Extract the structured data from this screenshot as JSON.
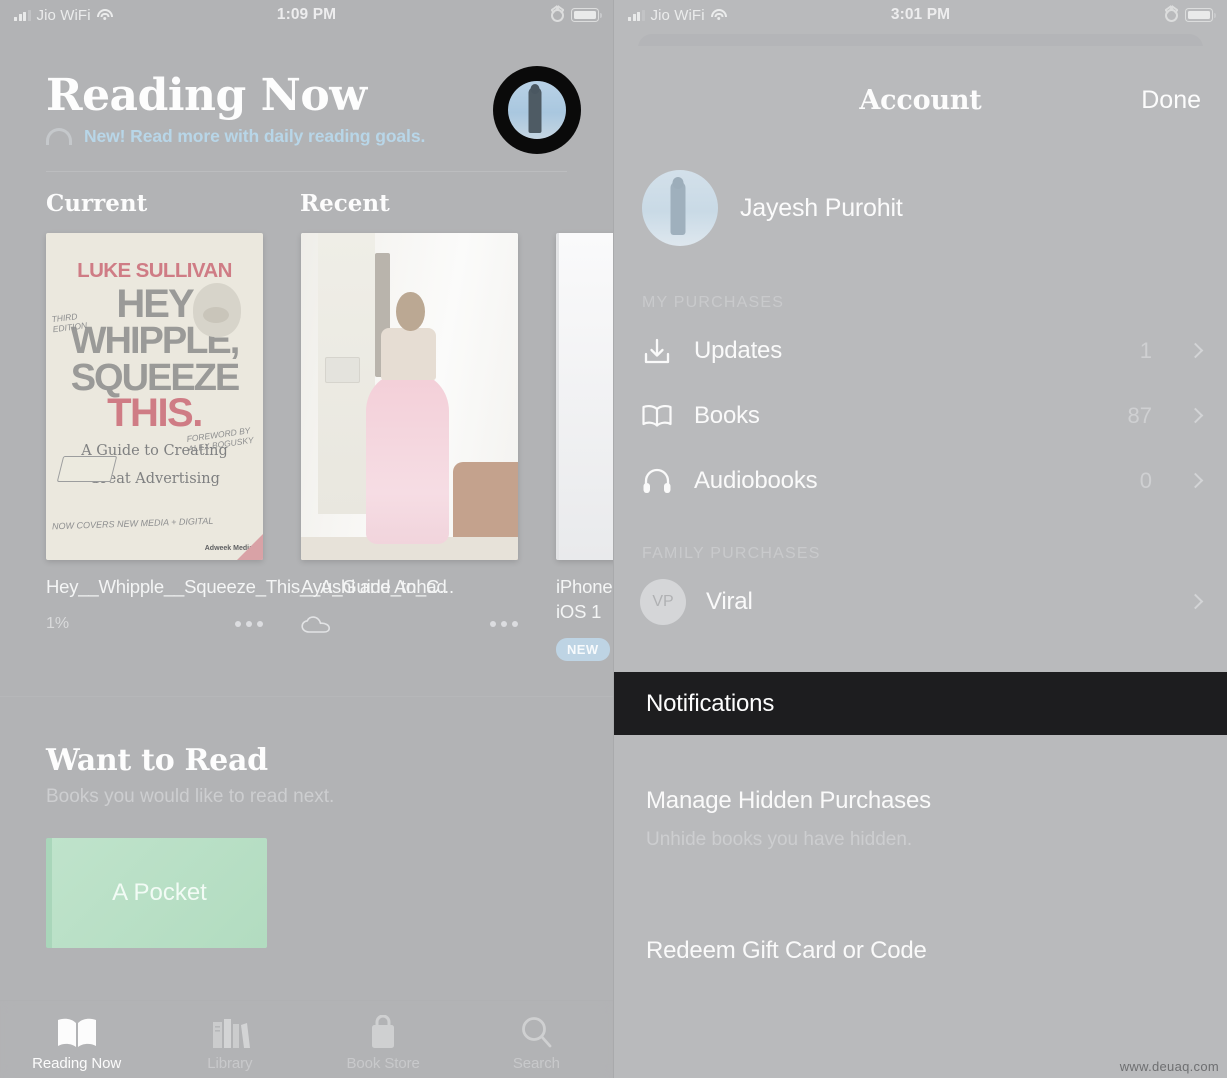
{
  "left": {
    "statusbar": {
      "carrier": "Jio WiFi",
      "time": "1:09 PM"
    },
    "header": {
      "title": "Reading Now"
    },
    "goal_banner": {
      "text": "New! Read more with daily reading goals."
    },
    "shelves": [
      {
        "heading": "Current"
      },
      {
        "heading": "Recent"
      }
    ],
    "cards": [
      {
        "title": "Hey__Whipple__Squeeze_This__A_Guide_to_C...",
        "progress": "1%",
        "more": "more-options",
        "cover": {
          "author": "LUKE SULLIVAN",
          "line1": "HEY",
          "line2": "WHIPPLE,",
          "line3": "SQUEEZE",
          "line4": "THIS.",
          "subtitle_1": "A Guide to Creating",
          "subtitle_2": "Great Advertising",
          "edition_note": "THIRD EDITION",
          "foreword_note": "FOREWORD BY ALEX BOGUSKY",
          "media_note": "NOW COVERS NEW MEDIA + DIGITAL",
          "publisher": "Adweek Media"
        }
      },
      {
        "title": "Ayushi and Anhad",
        "status_icon": "cloud-download",
        "more": "more-options"
      },
      {
        "title": "iPhone iOS 1",
        "badge": "NEW"
      }
    ],
    "want_to_read": {
      "title": "Want to Read",
      "subtitle": "Books you would like to read next.",
      "cover_title": "A Pocket"
    },
    "tabbar": [
      {
        "label": "Reading Now",
        "icon": "open-book-icon",
        "active": true
      },
      {
        "label": "Library",
        "icon": "bookshelf-icon",
        "active": false
      },
      {
        "label": "Book Store",
        "icon": "shopping-bag-icon",
        "active": false
      },
      {
        "label": "Search",
        "icon": "magnifier-icon",
        "active": false
      }
    ]
  },
  "right": {
    "statusbar": {
      "carrier": "Jio WiFi",
      "time": "3:01 PM"
    },
    "nav": {
      "title": "Account",
      "done": "Done"
    },
    "account": {
      "name": "Jayesh Purohit"
    },
    "my_purchases": {
      "heading": "MY PURCHASES",
      "items": [
        {
          "label": "Updates",
          "count": "1",
          "icon": "download-tray-icon"
        },
        {
          "label": "Books",
          "count": "87",
          "icon": "open-book-icon"
        },
        {
          "label": "Audiobooks",
          "count": "0",
          "icon": "headphones-icon"
        }
      ]
    },
    "family_purchases": {
      "heading": "FAMILY PURCHASES",
      "items": [
        {
          "label": "Viral",
          "initials": "VP"
        }
      ]
    },
    "notifications": {
      "label": "Notifications",
      "highlighted": true
    },
    "hidden_purchases": {
      "title": "Manage Hidden Purchases",
      "subtitle": "Unhide books you have hidden."
    },
    "redeem": {
      "title": "Redeem Gift Card or Code"
    }
  },
  "watermark": "www.deuaq.com",
  "colors": {
    "banner_blue": "#b8d6e8",
    "badge_blue": "#bed4e4",
    "notif_highlight": "#1d1d1f",
    "page_bg": "#b4b5b7"
  }
}
